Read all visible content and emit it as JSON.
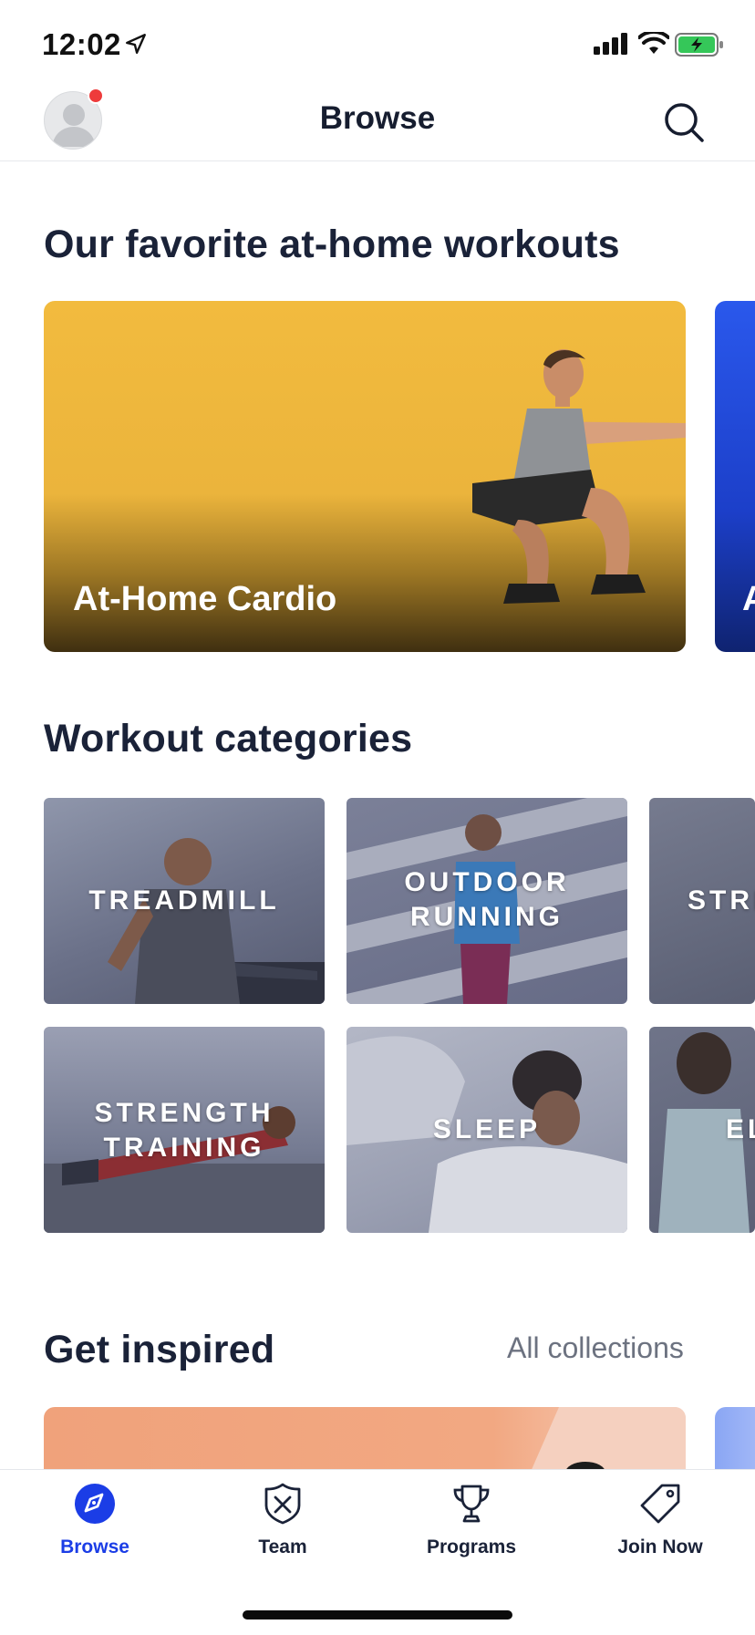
{
  "status_bar": {
    "time": "12:02"
  },
  "header": {
    "title": "Browse"
  },
  "featured": {
    "title": "Our favorite at-home workouts",
    "cards": [
      {
        "label": "At-Home Cardio"
      },
      {
        "label": "A"
      }
    ]
  },
  "categories": {
    "title": "Workout categories",
    "tiles": [
      {
        "label": "TREADMILL"
      },
      {
        "label": "OUTDOOR\nRUNNING"
      },
      {
        "label": "STRI"
      },
      {
        "label": "STRENGTH\nTRAINING"
      },
      {
        "label": "SLEEP"
      },
      {
        "label": "ELL"
      }
    ]
  },
  "inspired": {
    "title": "Get inspired",
    "link_label": "All collections"
  },
  "tabbar": {
    "items": [
      {
        "label": "Browse",
        "icon": "compass-icon",
        "active": true
      },
      {
        "label": "Team",
        "icon": "shield-icon"
      },
      {
        "label": "Programs",
        "icon": "trophy-icon"
      },
      {
        "label": "Join Now",
        "icon": "tag-icon"
      }
    ]
  },
  "colors": {
    "accent": "#1b3de6",
    "text": "#1a2238",
    "notification": "#ee3b3b",
    "battery": "#35c759",
    "featured_card": "#f2bb3e"
  }
}
